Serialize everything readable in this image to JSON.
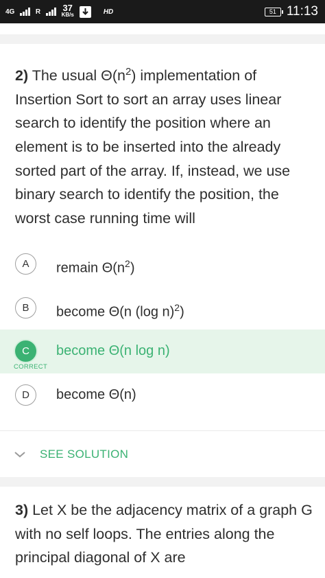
{
  "status_bar": {
    "network_1": "4G",
    "network_2": "R",
    "speed_value": "37",
    "speed_unit": "KB/s",
    "hd_label": "HD",
    "battery": "51",
    "time": "11:13"
  },
  "question_2": {
    "number": "2)",
    "text_a": " The usual Θ(n",
    "sup_a": "2",
    "text_b": ") implementation of Insertion Sort to sort an array uses linear search to identify the position where an element is to be inserted into the already sorted part of the array. If, instead, we use binary search to identify the position, the worst case running time will"
  },
  "options": [
    {
      "letter": "A",
      "text": "remain Θ(n",
      "sup": "2",
      "tail": ")",
      "correct": false
    },
    {
      "letter": "B",
      "text": "become Θ(n (log n)",
      "sup": "2",
      "tail": ")",
      "correct": false
    },
    {
      "letter": "C",
      "text": "become Θ(n log n)",
      "sup": "",
      "tail": "",
      "correct": true
    },
    {
      "letter": "D",
      "text": "become Θ(n)",
      "sup": "",
      "tail": "",
      "correct": false
    }
  ],
  "correct_label": "CORRECT",
  "see_solution_label": "SEE SOLUTION",
  "question_3": {
    "number": "3)",
    "text": " Let X be the adjacency matrix of a graph G with no self loops. The entries along the principal diagonal of X are"
  },
  "colors": {
    "accent_green": "#3bb273",
    "correct_bg": "#e6f5ea",
    "status_bar_bg": "#1a1a1a"
  },
  "icons": [
    "signal-icon",
    "download-icon",
    "battery-icon",
    "chevron-down-icon"
  ]
}
